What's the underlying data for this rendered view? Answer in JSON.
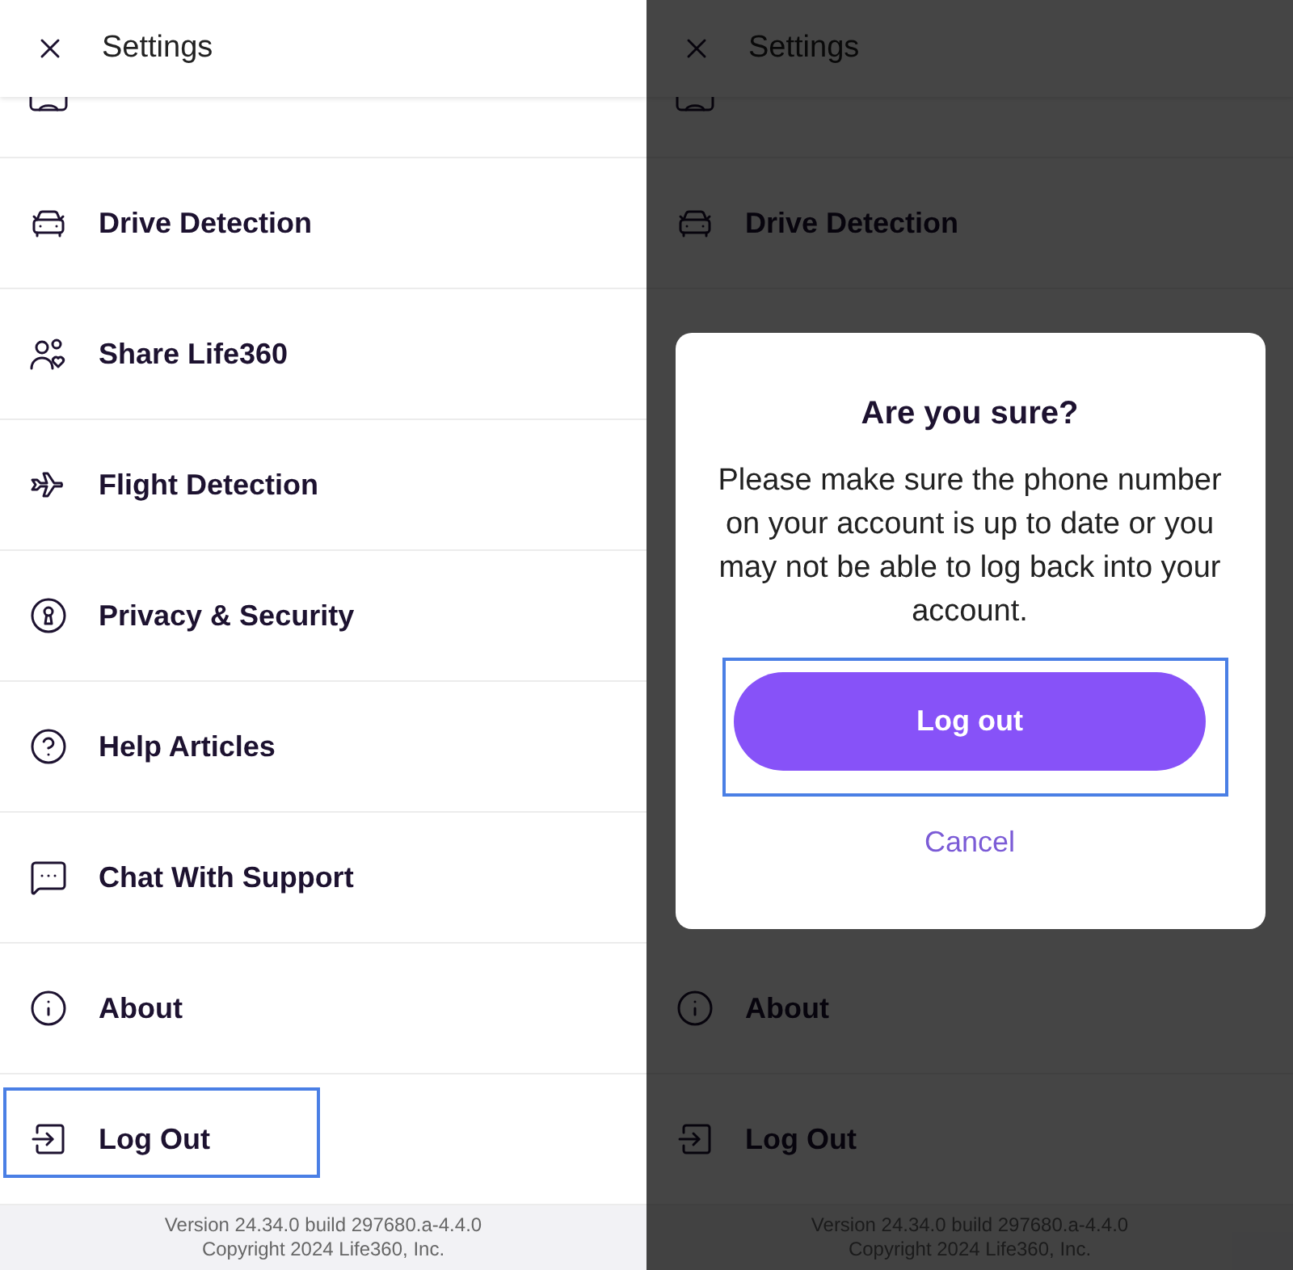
{
  "screens": [
    {
      "dimmed": false,
      "header": {
        "title": "Settings"
      },
      "items": [
        {
          "kind": "account",
          "highlighted": false
        },
        {
          "kind": "drive",
          "label": "Drive Detection",
          "highlighted": false
        },
        {
          "kind": "share",
          "label": "Share Life360",
          "highlighted": false
        },
        {
          "kind": "flight",
          "label": "Flight Detection",
          "highlighted": false
        },
        {
          "kind": "privacy",
          "label": "Privacy & Security",
          "highlighted": false
        },
        {
          "kind": "help",
          "label": "Help Articles",
          "highlighted": false
        },
        {
          "kind": "chat",
          "label": "Chat With Support",
          "highlighted": false
        },
        {
          "kind": "about",
          "label": "About",
          "highlighted": false
        },
        {
          "kind": "logout",
          "label": "Log Out",
          "highlighted": true
        }
      ],
      "footer": {
        "version": "Version 24.34.0 build 297680.a-4.4.0",
        "copyright": "Copyright 2024 Life360, Inc."
      }
    },
    {
      "dimmed": true,
      "header": {
        "title": "Settings"
      },
      "items": [
        {
          "kind": "account",
          "highlighted": false
        },
        {
          "kind": "drive",
          "label": "Drive Detection",
          "highlighted": false
        }
      ],
      "dialog": {
        "title": "Are you sure?",
        "message": "Please make sure the phone number on your account is up to date or you may not be able to log back into your account.",
        "buttons": [
          {
            "kind": "primary",
            "label": "Log out",
            "highlighted": true
          },
          {
            "kind": "link",
            "label": "Cancel",
            "highlighted": false
          }
        ]
      },
      "items_below": [
        {
          "kind": "about",
          "label": "About",
          "highlighted": false
        },
        {
          "kind": "logout",
          "label": "Log Out",
          "highlighted": false
        }
      ],
      "footer": {
        "version": "Version 24.34.0 build 297680.a-4.4.0",
        "copyright": "Copyright 2024 Life360, Inc."
      }
    }
  ]
}
